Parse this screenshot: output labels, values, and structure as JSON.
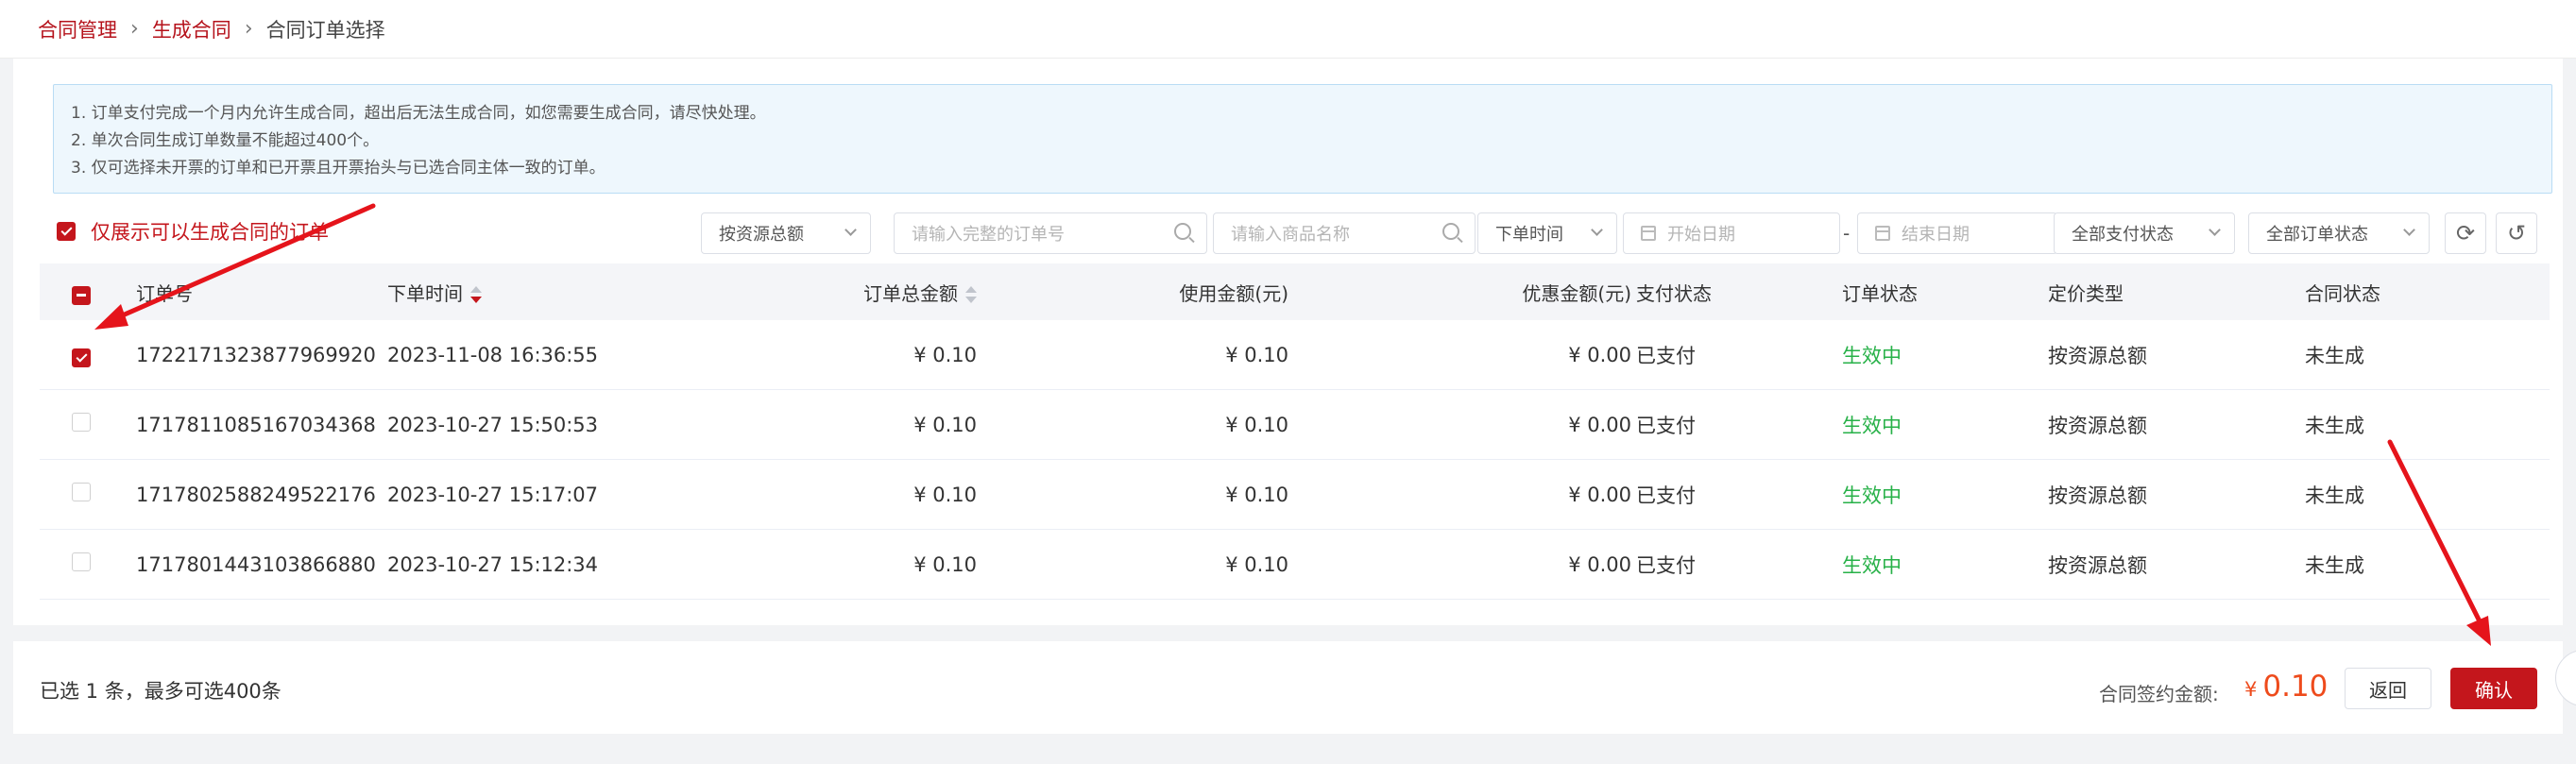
{
  "breadcrumb": {
    "items": [
      "合同管理",
      "生成合同"
    ],
    "current": "合同订单选择",
    "separator": ">"
  },
  "notice": {
    "lines": [
      "1. 订单支付完成一个月内允许生成合同，超出后无法生成合同，如您需要生成合同，请尽快处理。",
      "2. 单次合同生成订单数量不能超过400个。",
      "3. 仅可选择未开票的订单和已开票且开票抬头与已选合同主体一致的订单。"
    ]
  },
  "filters": {
    "only_generatable_label": "仅展示可以生成合同的订单",
    "only_generatable_checked": true,
    "amount_type_value": "按资源总额",
    "order_no_placeholder": "请输入完整的订单号",
    "product_placeholder": "请输入商品名称",
    "time_type_value": "下单时间",
    "start_date_placeholder": "开始日期",
    "range_separator": "-",
    "end_date_placeholder": "结束日期",
    "pay_status_value": "全部支付状态",
    "order_status_value": "全部订单状态"
  },
  "table": {
    "headers": {
      "order_no": "订单号",
      "order_time": "下单时间",
      "total_amount": "订单总金额",
      "used_amount": "使用金额(元)",
      "discount_amount": "优惠金额(元)",
      "pay_status": "支付状态",
      "order_status": "订单状态",
      "pricing_type": "定价类型",
      "contract_status": "合同状态"
    },
    "rows": [
      {
        "checked": true,
        "order_no": "1722171323877969920",
        "order_time": "2023-11-08 16:36:55",
        "total_amount": "¥ 0.10",
        "used_amount": "¥ 0.10",
        "discount_amount": "¥ 0.00",
        "pay_status": "已支付",
        "order_status": "生效中",
        "pricing_type": "按资源总额",
        "contract_status": "未生成"
      },
      {
        "checked": false,
        "order_no": "1717811085167034368",
        "order_time": "2023-10-27 15:50:53",
        "total_amount": "¥ 0.10",
        "used_amount": "¥ 0.10",
        "discount_amount": "¥ 0.00",
        "pay_status": "已支付",
        "order_status": "生效中",
        "pricing_type": "按资源总额",
        "contract_status": "未生成"
      },
      {
        "checked": false,
        "order_no": "1717802588249522176",
        "order_time": "2023-10-27 15:17:07",
        "total_amount": "¥ 0.10",
        "used_amount": "¥ 0.10",
        "discount_amount": "¥ 0.00",
        "pay_status": "已支付",
        "order_status": "生效中",
        "pricing_type": "按资源总额",
        "contract_status": "未生成"
      },
      {
        "checked": false,
        "order_no": "1717801443103866880",
        "order_time": "2023-10-27 15:12:34",
        "total_amount": "¥ 0.10",
        "used_amount": "¥ 0.10",
        "discount_amount": "¥ 0.00",
        "pay_status": "已支付",
        "order_status": "生效中",
        "pricing_type": "按资源总额",
        "contract_status": "未生成"
      }
    ]
  },
  "footer": {
    "selection_info": "已选 1 条，最多可选400条",
    "amount_label": "合同签约金额:",
    "currency": "¥",
    "amount_value": "0.10",
    "back_label": "返回",
    "confirm_label": "确认"
  },
  "colors": {
    "brand": "#c4161c",
    "active_status": "#27b148",
    "amount": "#ee4b1c",
    "notice_bg": "#eef7fd"
  }
}
